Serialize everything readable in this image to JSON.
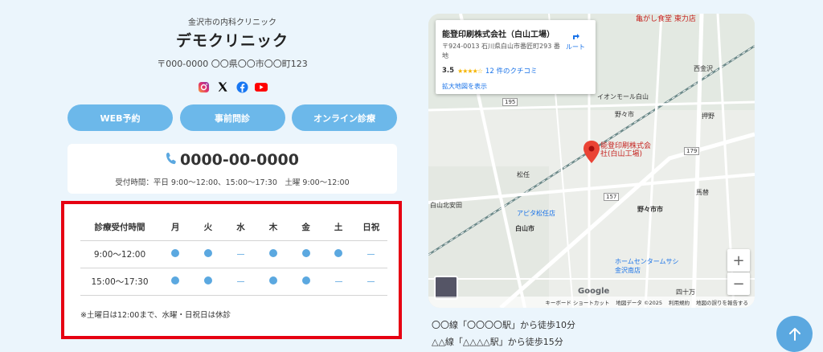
{
  "clinic": {
    "subtitle": "金沢市の内科クリニック",
    "name": "デモクリニック",
    "address": "〒000-0000 〇〇県〇〇市〇〇町123"
  },
  "sns": [
    "instagram-icon",
    "x-icon",
    "facebook-icon",
    "youtube-icon"
  ],
  "buttons": {
    "web": "WEB予約",
    "pre": "事前問診",
    "online": "オンライン診療"
  },
  "phone": {
    "number": "0000-00-0000",
    "hours": "受付時間：平日 9:00〜12:00、15:00〜17:30　土曜 9:00〜12:00"
  },
  "schedule": {
    "header": [
      "診療受付時間",
      "月",
      "火",
      "水",
      "木",
      "金",
      "土",
      "日祝"
    ],
    "rows": [
      {
        "time": "9:00〜12:00",
        "marks": [
          "dot",
          "dot",
          "dash",
          "dot",
          "dot",
          "dot",
          "dash"
        ]
      },
      {
        "time": "15:00〜17:30",
        "marks": [
          "dot",
          "dot",
          "dash",
          "dot",
          "dot",
          "dash",
          "dash"
        ]
      }
    ],
    "note": "※土曜日は12:00まで、水曜・日祝日は休診"
  },
  "map": {
    "card": {
      "name": "能登印刷株式会社（白山工場）",
      "address": "〒924-0013 石川県白山市番匠町293 番地",
      "rating": "3.5",
      "reviews": "12 件のクチコミ",
      "bigmap": "拡大地図を表示",
      "route": "ルート"
    },
    "labels": {
      "top_shop": "亀がし食堂 東力店",
      "nishi_kanazawa": "西金沢",
      "aeon": "イオンモール白山",
      "nonoichi": "野々市",
      "oshino": "押野",
      "marker": "能登印刷株式会社(白山工場)",
      "nonoichi_shi": "野々市市",
      "hakusan_kitayasuda": "白山北安田",
      "avito": "アピタ松任店",
      "hakusan_shi": "白山市",
      "matto": "松任",
      "umaki": "馬替",
      "homecenter": "ホームセンタームサシ金沢南店",
      "shijukken": "四十万",
      "keyboard": "キーボード ショートカット",
      "mapdata": "地図データ ©2025",
      "terms": "利用規約",
      "report": "地図の誤りを報告する",
      "google": "Google"
    },
    "zoom_in": "+",
    "zoom_out": "−"
  },
  "access": {
    "line1": "〇〇線「〇〇〇〇駅」から徒歩10分",
    "line2": "△△線「△△△△駅」から徒歩15分"
  },
  "colors": {
    "accent": "#6cb8ea",
    "highlight_border": "#e60012",
    "background": "#ebf5fc"
  }
}
